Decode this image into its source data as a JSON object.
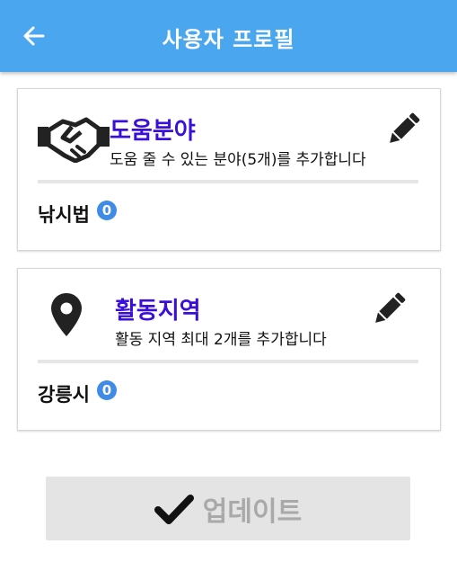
{
  "header": {
    "title": "사용자 프로필",
    "back_icon": "arrow-left-icon",
    "background": "#4aa6ef"
  },
  "help_card": {
    "icon": "handshake-icon",
    "title": "도움분야",
    "description": "도움 줄 수 있는 분야(5개)를 추가합니다",
    "edit_icon": "pencil-icon",
    "items": [
      {
        "label": "낚시법",
        "count": "0"
      }
    ]
  },
  "region_card": {
    "icon": "map-marker-icon",
    "title": "활동지역",
    "description": "활동 지역 최대 2개를 추가합니다",
    "edit_icon": "pencil-icon",
    "items": [
      {
        "label": "강릉시",
        "count": "0"
      }
    ]
  },
  "update_button": {
    "label": "업데이트",
    "icon": "checkmark-icon"
  },
  "colors": {
    "accent": "#3a0fd8",
    "badge": "#3f8be6",
    "button_bg": "#e4e4e4",
    "button_text": "#a9a9a9"
  }
}
